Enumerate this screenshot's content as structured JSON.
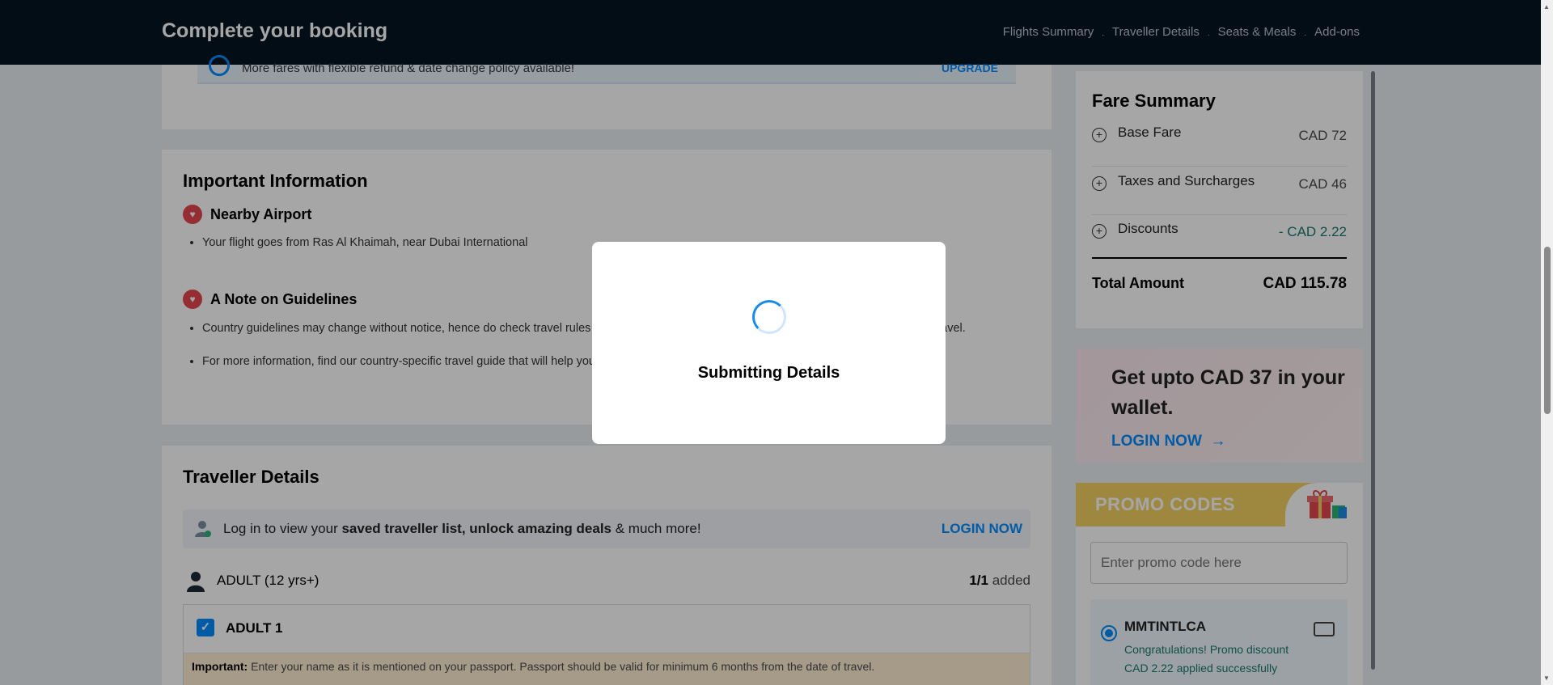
{
  "header": {
    "title": "Complete your booking",
    "steps": [
      "Flights Summary",
      "Traveller Details",
      "Seats & Meals",
      "Add-ons"
    ],
    "separator": "."
  },
  "upgrade": {
    "text": "More fares with flexible refund & date change policy available!",
    "link": "UPGRADE"
  },
  "important_info": {
    "title": "Important Information",
    "sections": [
      {
        "heading": "Nearby Airport",
        "bullets": [
          "Your flight goes from Ras Al Khaimah, near Dubai International"
        ]
      },
      {
        "heading": "A Note on Guidelines",
        "bullets": [
          "Country guidelines may change without notice, hence do check travel rules of the respective country prior to booking as well as commencing travel.",
          "For more information, find our country-specific travel guide that will help you"
        ]
      }
    ]
  },
  "traveller": {
    "title": "Traveller Details",
    "login_text_pre": "Log in to view your ",
    "login_text_bold": "saved traveller list, unlock amazing deals",
    "login_text_post": " & much more!",
    "login_link": "LOGIN NOW",
    "adult_label": "ADULT (12 yrs+)",
    "adult_count": "1/1",
    "adult_added": "added",
    "adult1_label": "ADULT 1",
    "note_bold": "Important:",
    "note_text": " Enter your name as it is mentioned on your passport. Passport should be valid for minimum 6 months from the date of travel."
  },
  "fare": {
    "title": "Fare Summary",
    "rows": [
      {
        "label": "Base Fare",
        "value": "CAD 72"
      },
      {
        "label": "Taxes and Surcharges",
        "value": "CAD 46"
      },
      {
        "label": "Discounts",
        "value": "- CAD 2.22"
      }
    ],
    "total_label": "Total Amount",
    "total_value": "CAD 115.78"
  },
  "wallet": {
    "text": "Get upto CAD 37 in your wallet.",
    "link": "LOGIN NOW",
    "arrow": "→"
  },
  "promo": {
    "title": "PROMO CODES",
    "placeholder": "Enter promo code here",
    "code": "MMTINTLCA",
    "message": "Congratulations! Promo discount CAD 2.22 applied successfully"
  },
  "modal": {
    "message": "Submitting Details"
  },
  "colors": {
    "accent": "#008cff",
    "topbar": "#051423",
    "success": "#1a7971",
    "promo_header": "#f3d163"
  }
}
